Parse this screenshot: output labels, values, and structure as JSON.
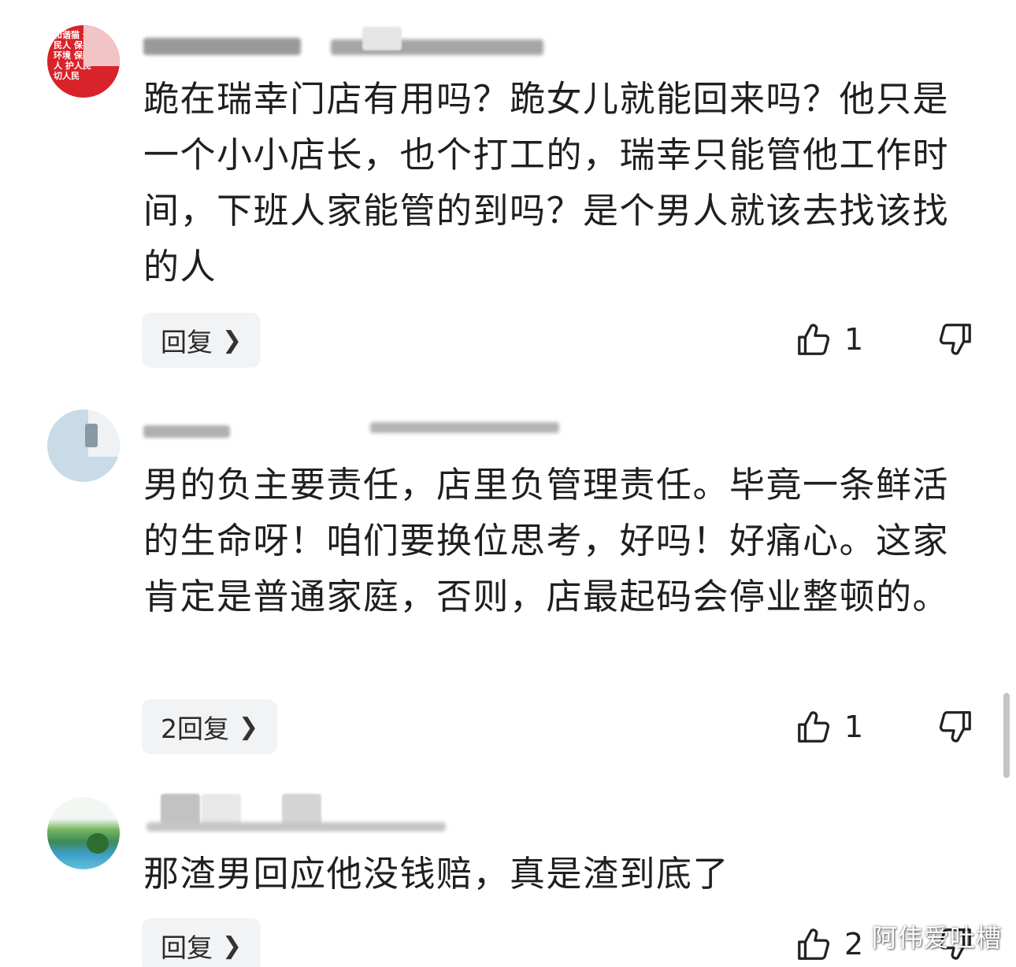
{
  "comments": [
    {
      "body": "跪在瑞幸门店有用吗？跪女儿就能回来吗？他只是一个小小店长，也个打工的，瑞幸只能管他工作时间，下班人家能管的到吗？是个男人就该去找该找的人",
      "reply_label": "回复",
      "like_count": "1",
      "avatar_text": "和谐猫 全民人 保护环境 保障 人 护人民 切人民"
    },
    {
      "body": "男的负主要责任，店里负管理责任。毕竟一条鲜活的生命呀！咱们要换位思考，好吗！好痛心。这家肯定是普通家庭，否则，店最起码会停业整顿的。",
      "reply_label": "2回复",
      "like_count": "1"
    },
    {
      "body": "那渣男回应他没钱赔，真是渣到底了",
      "reply_label": "回复",
      "like_count": "2"
    }
  ],
  "watermark": "阿伟爱吐槽",
  "icons": {
    "chevron": "chevron-right-icon",
    "like": "thumbs-up-icon",
    "dislike": "thumbs-down-icon"
  }
}
